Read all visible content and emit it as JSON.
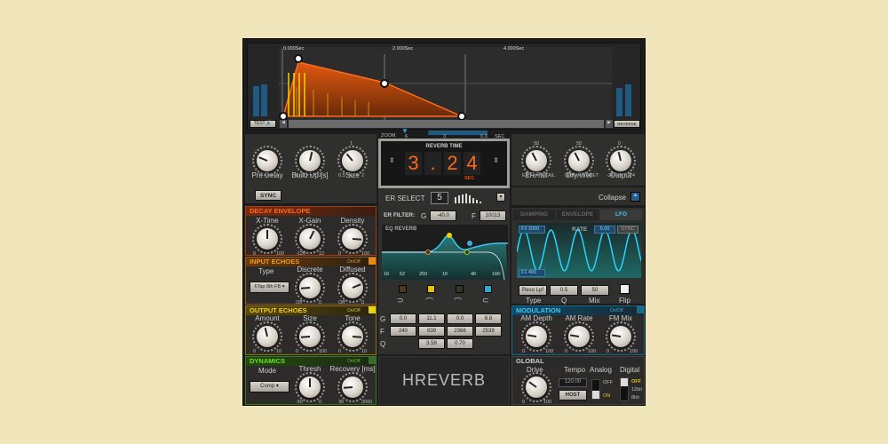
{
  "display": {
    "time_labels": [
      "0.000Sec",
      "2.000Sec",
      "4.000Sec"
    ],
    "test_label": "TEST",
    "reverse_label": "REVERSE",
    "zoom_label": "ZOOM",
    "zoom_ticks": [
      "6",
      "3",
      "0.3",
      "SEC"
    ]
  },
  "reverb_time": {
    "title": "REVERB TIME",
    "digits": [
      "3",
      ".",
      "2",
      "4"
    ],
    "unit": "SEC"
  },
  "er_select": {
    "label": "ER SELECT",
    "value": "5"
  },
  "top_left": {
    "knobs": [
      {
        "label": "Pre Delay",
        "min": "",
        "max": "",
        "value": 0.25
      },
      {
        "label": "Build Up [s]",
        "min": "0",
        "max": "2",
        "value": 0.55
      },
      {
        "label": "Size",
        "min": "0.5",
        "max": "2",
        "value": 0.35,
        "top": "1"
      }
    ],
    "sync": "SYNC"
  },
  "top_right": {
    "knobs": [
      {
        "label": "ER/Tail",
        "min": "ER",
        "max": "TAIL",
        "top": "50",
        "value": 0.4
      },
      {
        "label": "Dry/Wet",
        "min": "DRY",
        "max": "WET",
        "top": "50",
        "value": 0.4
      },
      {
        "label": "Output",
        "min": "-24",
        "max": "24",
        "top": "0",
        "value": 0.45
      }
    ],
    "collapse": "Collapse"
  },
  "decay": {
    "title": "DECAY ENVELOPE",
    "knobs": [
      {
        "label": "X-Time",
        "min": "0",
        "max": "100",
        "value": 0.5
      },
      {
        "label": "X-Gain",
        "min": "-120",
        "max": "12",
        "value": 0.6
      },
      {
        "label": "Density",
        "min": "0",
        "max": "100",
        "value": 0.85
      }
    ]
  },
  "input_echoes": {
    "title": "INPUT ECHOES",
    "onoff": "On/Off",
    "type_label": "Type",
    "type_value": "6Tap 8th FB",
    "knobs": [
      {
        "label": "Discrete",
        "min": "Off",
        "max": "0",
        "value": 0.15
      },
      {
        "label": "Diffused",
        "min": "Off",
        "max": "0",
        "value": 0.75
      }
    ]
  },
  "output_echoes": {
    "title": "OUTPUT ECHOES",
    "onoff": "On/Off",
    "knobs": [
      {
        "label": "Amount",
        "min": "0",
        "max": "10",
        "value": 0.45
      },
      {
        "label": "Size",
        "min": "0",
        "max": "100",
        "value": 0.15
      },
      {
        "label": "Tone",
        "min": "0",
        "max": "10",
        "value": 0.85
      }
    ]
  },
  "dynamics": {
    "title": "DYNAMICS",
    "onoff": "On/Off",
    "mode_label": "Mode",
    "mode_value": "Comp",
    "knobs": [
      {
        "label": "Thresh",
        "min": "-50",
        "max": "0",
        "value": 0.5
      },
      {
        "label": "Recovery [ms]",
        "min": "30",
        "max": "3000",
        "value": 0.15
      }
    ]
  },
  "er_filter": {
    "label": "ER FILTER:",
    "g_label": "G",
    "g_value": "-40.0",
    "f_label": "F",
    "f_value": "10013"
  },
  "eq": {
    "title": "EQ REVERB",
    "freqs": [
      "16",
      "62",
      "250",
      "1K",
      "4K",
      "16K"
    ],
    "band_colors": [
      "#4a3a22",
      "#e8c400",
      "#2e3a22",
      "#2aa8d8"
    ],
    "rows": {
      "G": [
        "0.0",
        "11.1",
        "0.0",
        "6.8"
      ],
      "F": [
        "240",
        "839",
        "2366",
        "2539"
      ],
      "Q": [
        "",
        "3.58",
        "0.70",
        ""
      ]
    }
  },
  "logo": "HREVERB",
  "tabs": [
    "DAMPING",
    "ENVELOPE",
    "LFO"
  ],
  "lfo": {
    "f2_label": "F2",
    "f2": "2000",
    "rate_label": "RATE",
    "rate": "5.00",
    "sync": "SYNC",
    "f1_label": "F1",
    "f1": "400",
    "buttons": [
      "Reso Lpf",
      "0.5",
      "50"
    ],
    "labels": [
      "Type",
      "Q",
      "Mix",
      "Flip"
    ]
  },
  "modulation": {
    "title": "MODULATION",
    "onoff": "On/Off",
    "knobs": [
      {
        "label": "AM Depth",
        "min": "0",
        "max": "100",
        "value": 0.2
      },
      {
        "label": "AM Rate",
        "min": "0",
        "max": "100",
        "value": 0.2
      },
      {
        "label": "FM Mix",
        "min": "0",
        "max": "100",
        "value": 0.2
      }
    ]
  },
  "global": {
    "title": "GLOBAL",
    "drive_label": "Drive",
    "drive_min": "0",
    "drive_max": "100",
    "drive_value": 0.3,
    "tempo_label": "Tempo",
    "tempo": "120.00",
    "host": "HOST",
    "analog_label": "Analog",
    "analog_off": "OFF",
    "analog_on": "ON",
    "digital_label": "Digital",
    "digital_opts": [
      "OFF",
      "12bit",
      "8bit"
    ]
  }
}
